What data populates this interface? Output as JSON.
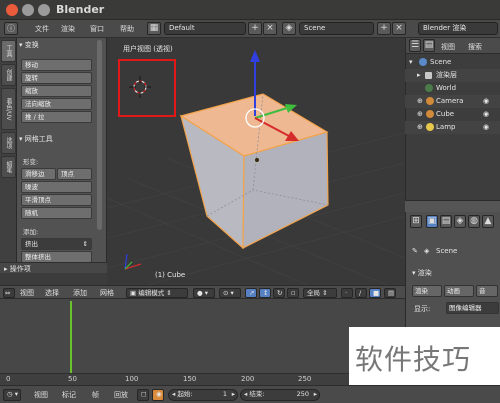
{
  "window": {
    "title": "Blender"
  },
  "infobar": {
    "menus": [
      "文件",
      "渲染",
      "窗口",
      "帮助"
    ],
    "screen_layout": "Default",
    "scene": "Scene",
    "render_engine": "Blender 渲染"
  },
  "toolshelf": {
    "tabs": [
      "工具",
      "创建",
      "着色/UV",
      "选项",
      "蜡笔"
    ],
    "transform_header": "变换",
    "transform_buttons": [
      "移动",
      "旋转",
      "缩放",
      "法向缩放",
      "推 / 拉"
    ],
    "mesh_tools_header": "网格工具",
    "deform_label": "形变:",
    "deform_buttons": [
      "滑移边",
      "顶点",
      "噪波",
      "平滑顶点",
      "随机"
    ],
    "add_label": "添加:",
    "extrude_value": "挤出",
    "extrude_region": "整体挤出",
    "operator_header": "操作项"
  },
  "viewport": {
    "view_label": "用户视图 (透视)",
    "object_label": "(1) Cube"
  },
  "viewport_header": {
    "menus": [
      "视图",
      "选择",
      "添加",
      "网格"
    ],
    "mode": "编辑模式",
    "orientation": "全局"
  },
  "outliner": {
    "menus": [
      "视图",
      "搜索"
    ],
    "items": [
      "Scene",
      "渲染层",
      "World",
      "Camera",
      "Cube",
      "Lamp"
    ]
  },
  "properties": {
    "scene": "Scene",
    "section_render": "渲染",
    "render_btn": "渲染",
    "animation_btn": "动画",
    "audio_btn": "音",
    "display_label": "显示:",
    "display_value": "图像编辑器"
  },
  "timeline": {
    "ruler_labels": [
      "0",
      "50",
      "100",
      "150",
      "200",
      "250"
    ],
    "menus": [
      "视图",
      "标记",
      "帧",
      "回放"
    ],
    "start_label": "起始:",
    "start_value": "1",
    "end_label": "结束:",
    "end_value": "250"
  },
  "watermark": {
    "text": "软件技巧"
  },
  "colors": {
    "accent_blue": "#5680c2",
    "selection_orange": "#f3a34a",
    "axis_red": "#d62b2b",
    "axis_green": "#3fbd3f",
    "axis_blue": "#2f3fe0",
    "playhead_green": "#6bc22f",
    "highlight_red": "#e01818"
  },
  "icons": [
    "close-icon",
    "minimize-icon",
    "maximize-icon",
    "3d-cursor-icon",
    "eye-icon",
    "camera-icon",
    "mesh-icon",
    "lamp-icon",
    "world-icon",
    "play-icon"
  ]
}
